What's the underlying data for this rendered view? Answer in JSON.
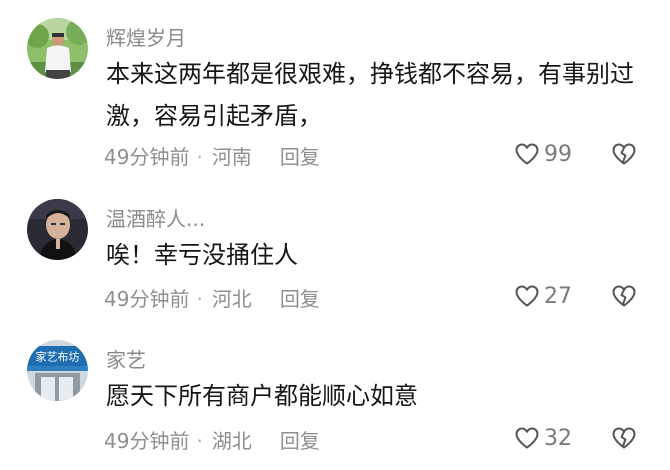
{
  "comments": [
    {
      "username": "辉煌岁月",
      "text": "本来这两年都是很艰难，挣钱都不容易，有事别过激，容易引起矛盾，",
      "time": "49分钟前",
      "location": "河南",
      "reply_label": "回复",
      "likes": "99",
      "avatar_icon": "man-outdoor-avatar-icon"
    },
    {
      "username": "温酒醉人...",
      "text": "唉！幸亏没捅住人",
      "time": "49分钟前",
      "location": "河北",
      "reply_label": "回复",
      "likes": "27",
      "avatar_icon": "man-portrait-avatar-icon"
    },
    {
      "username": "家艺",
      "text": "愿天下所有商户都能顺心如意",
      "time": "49分钟前",
      "location": "湖北",
      "reply_label": "回复",
      "likes": "32",
      "avatar_icon": "shop-sign-avatar-icon",
      "avatar_sign": "家艺布坊"
    }
  ],
  "separator": "·",
  "colors": {
    "username": "#8a8a8a",
    "text": "#161616",
    "meta": "#8f8f8f",
    "icon": "#555555"
  }
}
